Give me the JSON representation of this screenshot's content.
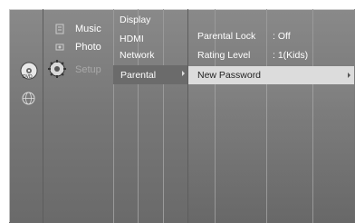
{
  "categories": [
    {
      "id": "music",
      "label": "Music"
    },
    {
      "id": "photo",
      "label": "Photo"
    },
    {
      "id": "setup",
      "label": "Setup"
    }
  ],
  "submenu": [
    "Display",
    "HDMI",
    "Network",
    "Parental"
  ],
  "panel": {
    "rows": [
      {
        "label": "Parental Lock",
        "value": ": Off"
      },
      {
        "label": "Rating Level",
        "value": ": 1(Kids)"
      }
    ],
    "selected_row": "New Password"
  },
  "colors": {
    "background": "#7a7a7a",
    "highlight": "#dcdcdc",
    "text": "#ffffff"
  },
  "icons": [
    "disc-icon",
    "network-globe-icon",
    "music-icon",
    "photo-icon",
    "gear-icon"
  ]
}
